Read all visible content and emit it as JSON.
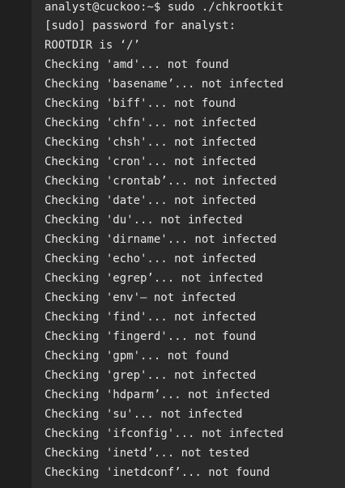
{
  "terminal": {
    "lines": [
      "analyst@cuckoo:~$ sudo ./chkrootkit",
      "[sudo] password for analyst:",
      "ROOTDIR is ‘/’",
      "Checking 'amd'... not found",
      "Checking 'basename’... not infected",
      "Checking 'biff'... not found",
      "Checking 'chfn'... not infected",
      "Checking 'chsh'... not infected",
      "Checking 'cron'... not infected",
      "Checking 'crontab’... not infected",
      "Checking 'date'... not infected",
      "Checking 'du'... not infected",
      "Checking 'dirname'... not infected",
      "Checking 'echo'... not infected",
      "Checking 'egrep’... not infected",
      "Checking 'env'— not infected",
      "Checking 'find'... not infected",
      "Checking 'fingerd'... not found",
      "Checking 'gpm'... not found",
      "Checking 'grep'... not infected",
      "Checking 'hdparm’... not infected",
      "Checking 'su'... not infected",
      "Checking 'ifconfig'... not infected",
      "Checking 'inetd’... not tested",
      "Checking 'inetdconf’... not found"
    ]
  }
}
